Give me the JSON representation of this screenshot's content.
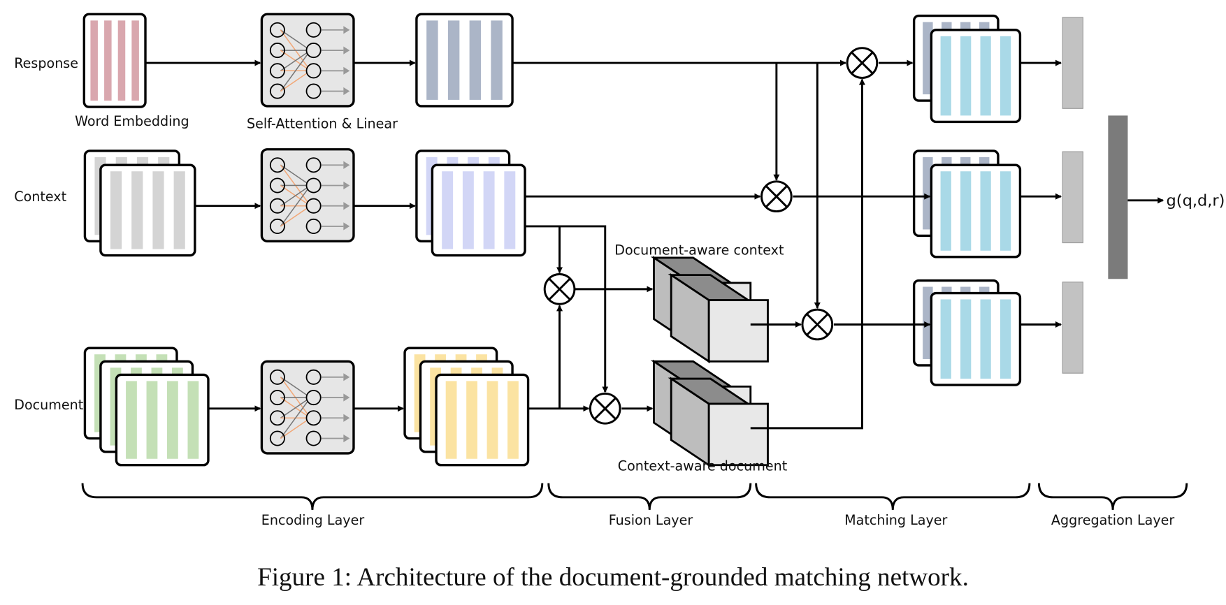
{
  "rows": {
    "response": "Response",
    "context": "Context",
    "document": "Document"
  },
  "labels": {
    "word_embedding": "Word Embedding",
    "self_attention": "Self-Attention & Linear",
    "document_aware_context": "Document-aware context",
    "context_aware_document": "Context-aware document",
    "output": "g(q,d,r)"
  },
  "layers": {
    "encoding": "Encoding Layer",
    "fusion": "Fusion Layer",
    "matching": "Matching Layer",
    "aggregation": "Aggregation Layer"
  },
  "caption": "Figure 1: Architecture of the document-grounded matching network.",
  "colors": {
    "response_embedding": "#d9a7ae",
    "response_encoded": "#abb5c7",
    "context_embedding": "#d4d4d4",
    "context_encoded": "#d2d6f6",
    "document_embedding": "#c4e0b6",
    "document_encoded": "#fbe3a2",
    "matching": "#a9d9e7",
    "aggregation_small": "#c2c2c2",
    "aggregation_big": "#7b7b7b"
  }
}
